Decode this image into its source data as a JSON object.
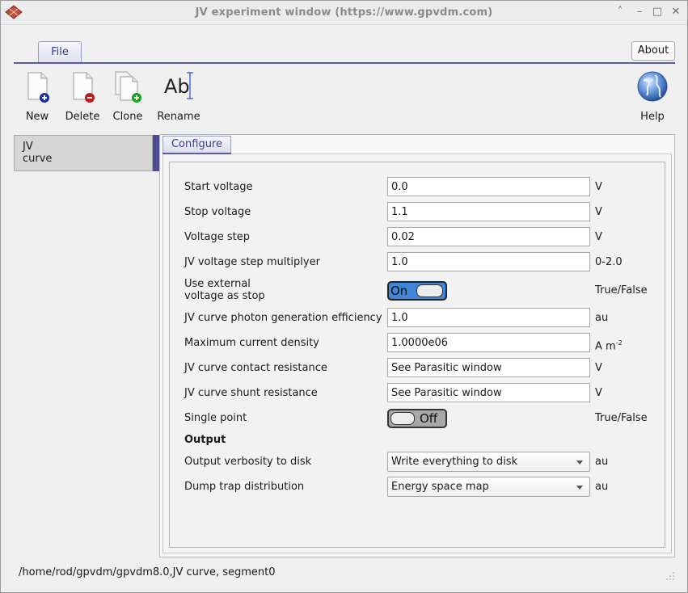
{
  "window": {
    "title": "JV experiment window (https://www.gpvdm.com)",
    "controls": {
      "shade": "˄",
      "minimize": "–",
      "maximize": "□",
      "close": "✕"
    }
  },
  "ribbon": {
    "file_tab": "File",
    "about_button": "About"
  },
  "toolbar": {
    "new_label": "New",
    "delete_label": "Delete",
    "clone_label": "Clone",
    "rename_label": "Rename",
    "rename_glyph": "Ab",
    "help_label": "Help",
    "icons": {
      "new": "new-document-icon",
      "delete": "delete-document-icon",
      "clone": "clone-document-icon",
      "rename": "rename-text-icon",
      "help": "globe-help-icon"
    }
  },
  "sidebar": {
    "items": [
      {
        "label_line1": "JV",
        "label_line2": "curve",
        "selected": true
      }
    ]
  },
  "notebook": {
    "tab_label": "Configure"
  },
  "form": {
    "rows": [
      {
        "label": "Start voltage",
        "value": "0.0",
        "unit": "V"
      },
      {
        "label": "Stop voltage",
        "value": "1.1",
        "unit": "V"
      },
      {
        "label": "Voltage step",
        "value": "0.02",
        "unit": "V"
      },
      {
        "label": "JV voltage step multiplyer",
        "value": "1.0",
        "unit": "0-2.0"
      },
      {
        "label_line1": "Use external",
        "label_line2": "voltage as stop",
        "switch_text": "On",
        "unit": "True/False"
      },
      {
        "label": "JV curve photon generation efficiency",
        "value": "1.0",
        "unit": "au"
      },
      {
        "label": "Maximum current density",
        "value": "1.0000e06",
        "unit": "A m",
        "unit_sup": "-2"
      },
      {
        "label": "JV curve contact resistance",
        "value": "See Parasitic window",
        "unit": "V"
      },
      {
        "label": "JV curve shunt resistance",
        "value": "See Parasitic window",
        "unit": "V"
      },
      {
        "label": "Single point",
        "switch_text": "Off",
        "unit": "True/False"
      }
    ],
    "output_title": "Output",
    "output_rows": [
      {
        "label": "Output verbosity to disk",
        "selected": "Write everything to disk",
        "unit": "au"
      },
      {
        "label": "Dump trap distribution",
        "selected": "Energy space map",
        "unit": "au"
      }
    ]
  },
  "status": {
    "path": "/home/rod/gpvdm/gpvdm8.0,JV curve, segment0"
  },
  "colors": {
    "accent": "#5a5aa8",
    "switch_on": "#3f86d9",
    "switch_off": "#a8a8a8"
  }
}
